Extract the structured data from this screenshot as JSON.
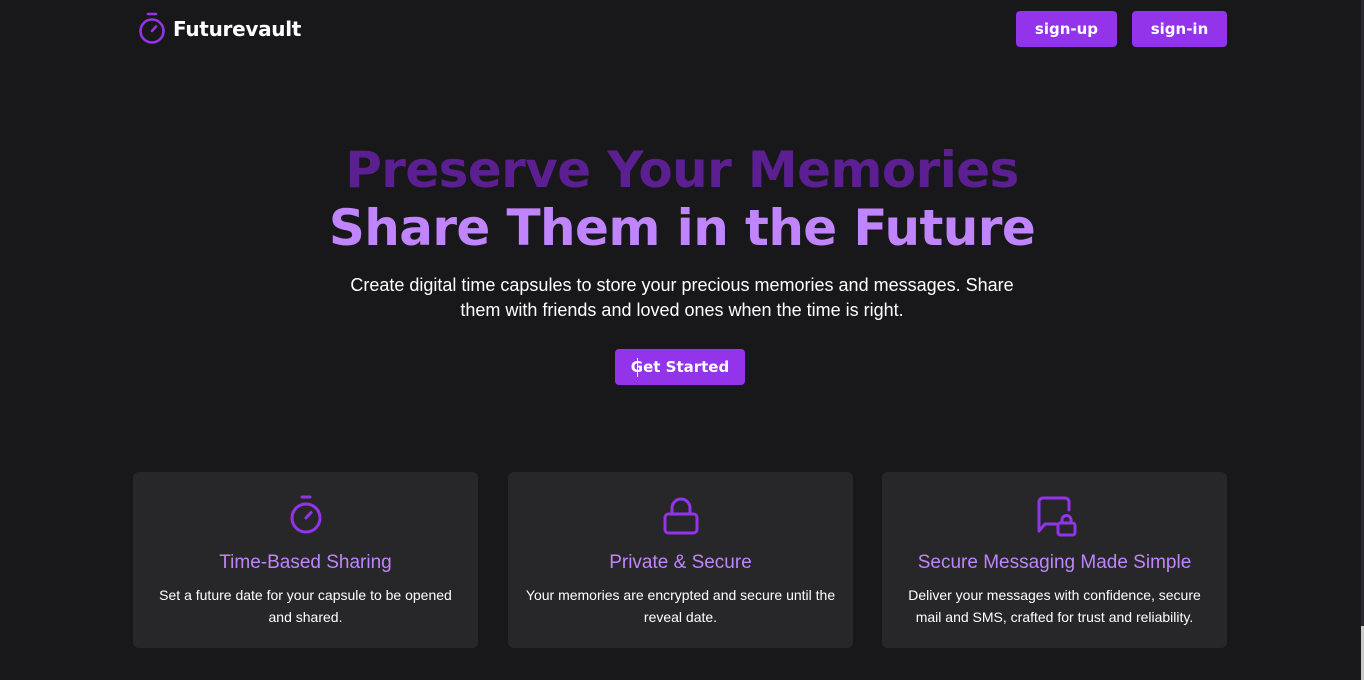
{
  "header": {
    "logo_text": "Futurevault",
    "signup_label": "sign-up",
    "signin_label": "sign-in"
  },
  "hero": {
    "line1": "Preserve Your Memories",
    "line2": "Share Them in the Future",
    "subtitle": "Create digital time capsules to store your precious memories and messages. Share them with friends and loved ones when the time is right.",
    "cta_label": "Get Started"
  },
  "features": [
    {
      "icon": "stopwatch-icon",
      "title": "Time-Based Sharing",
      "description": "Set a future date for your capsule to be opened and shared."
    },
    {
      "icon": "lock-icon",
      "title": "Private & Secure",
      "description": "Your memories are encrypted and secure until the reveal date."
    },
    {
      "icon": "message-lock-icon",
      "title": "Secure Messaging Made Simple",
      "description": "Deliver your messages with confidence, secure mail and SMS, crafted for trust and reliability."
    }
  ],
  "colors": {
    "background": "#18181b",
    "card_background": "#27272a",
    "accent": "#9333ea",
    "accent_light": "#c084fc",
    "accent_dark": "#5b1f91"
  }
}
